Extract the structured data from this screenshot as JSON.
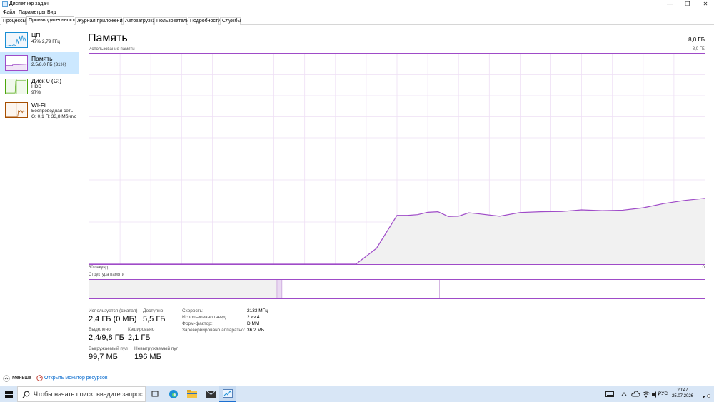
{
  "window": {
    "title": "Диспетчер задач",
    "minimize_glyph": "—",
    "maximize_glyph": "❐",
    "close_glyph": "✕"
  },
  "menu": [
    "Файл",
    "Параметры",
    "Вид"
  ],
  "tabs": [
    "Процессы",
    "Производительность",
    "Журнал приложений",
    "Автозагрузка",
    "Пользователи",
    "Подробности",
    "Службы"
  ],
  "sidebar": [
    {
      "name": "ЦП",
      "sub1": "47% 2,79 ГГц",
      "sub2": "",
      "color": "#1a8ed4"
    },
    {
      "name": "Память",
      "sub1": "2,5/8,0 ГБ (31%)",
      "sub2": "",
      "color": "#9f4bc8"
    },
    {
      "name": "Диск 0 (C:)",
      "sub1": "HDD",
      "sub2": "97%",
      "color": "#4da60c"
    },
    {
      "name": "Wi-Fi",
      "sub1": "Беспроводная сеть",
      "sub2": "О: 0,1 П: 33,8 Мбит/с",
      "color": "#a74f01"
    }
  ],
  "memory": {
    "title": "Память",
    "total": "8,0 ГБ",
    "usage_caption": "Использование памяти",
    "usage_max": "8,0 ГБ",
    "time_caption": "60 секунд",
    "time_end": "0",
    "structure_caption": "Структура памяти",
    "stats": {
      "in_use_label": "Используется (сжатая)",
      "in_use_value": "2,4 ГБ (0 МБ)",
      "available_label": "Доступно",
      "available_value": "5,5 ГБ",
      "committed_label": "Выделено",
      "committed_value": "2,4/9,8 ГБ",
      "cached_label": "Кэшировано",
      "cached_value": "2,1 ГБ",
      "paged_label": "Выгружаемый пул",
      "paged_value": "99,7 МБ",
      "nonpaged_label": "Невыгружаемый пул",
      "nonpaged_value": "196 МБ"
    },
    "right": {
      "speed_label": "Скорость:",
      "speed_value": "2133 МГц",
      "slots_label": "Использовано гнезд:",
      "slots_value": "2 из 4",
      "form_label": "Форм-фактор:",
      "form_value": "DIMM",
      "reserved_label": "Зарезервировано аппаратно:",
      "reserved_value": "36,2 МБ"
    }
  },
  "chart_data": {
    "type": "area",
    "title": "Использование памяти",
    "xlabel": "60 секунд",
    "ylabel": "",
    "ylim": [
      0,
      8.0
    ],
    "x": [
      60,
      55,
      50,
      45,
      40,
      35,
      34,
      32,
      30,
      29,
      28,
      27,
      26,
      25,
      24,
      23,
      22,
      20,
      18,
      16,
      14,
      12,
      10,
      8,
      6,
      4,
      2,
      0
    ],
    "series": [
      {
        "values": [
          0,
          0,
          0,
          0,
          0,
          0,
          0,
          0.6,
          1.85,
          1.85,
          1.88,
          1.97,
          1.99,
          1.81,
          1.82,
          1.95,
          1.91,
          1.82,
          1.96,
          1.99,
          2.0,
          2.06,
          2.03,
          2.05,
          2.14,
          2.3,
          2.42,
          2.5
        ]
      }
    ],
    "color": "#9f4bc8",
    "fill": "#f1f1f1",
    "grid": true
  },
  "structure": {
    "segments": [
      {
        "name": "in_use",
        "fraction": 0.305,
        "color": "#f1f1f1"
      },
      {
        "name": "modified",
        "fraction": 0.008,
        "color": "#eadaf2"
      },
      {
        "name": "standby",
        "fraction": 0.256,
        "color": "#ffffff"
      },
      {
        "name": "free",
        "fraction": 0.431,
        "color": "#ffffff"
      }
    ]
  },
  "footer": {
    "less_label": "Меньше",
    "resource_monitor_label": "Открыть монитор ресурсов"
  },
  "taskbar": {
    "search_placeholder": "Чтобы начать поиск, введите запрос",
    "lang": "РУС",
    "time": "20:47",
    "date": "25.07.2026"
  },
  "colors": {
    "accent": "#9f4bc8",
    "selected_bg": "#cce8ff",
    "taskbar_bg": "#d8e6f6",
    "link": "#0066cc"
  }
}
